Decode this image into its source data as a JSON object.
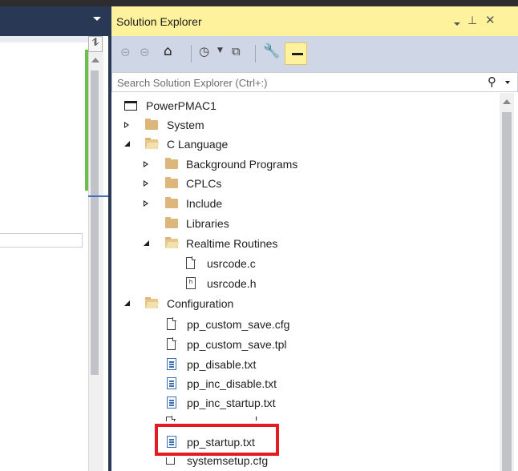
{
  "solution_explorer": {
    "title": "Solution Explorer",
    "pin_glyph": "Թ",
    "close_glyph": "✕",
    "toolbar": {
      "back_icon": "back-icon",
      "forward_icon": "forward-icon",
      "home_icon": "home-icon",
      "history_icon": "history-icon",
      "sync_icon": "sync-view-icon",
      "properties_icon": "wrench-icon",
      "preview_icon": "preview-icon"
    },
    "search_placeholder": "Search Solution Explorer (Ctrl+:)",
    "tree": {
      "project": "PowerPMAC1",
      "system": "System",
      "c_language": "C Language",
      "background_programs": "Background Programs",
      "cplcs": "CPLCs",
      "include": "Include",
      "libraries": "Libraries",
      "realtime_routines": "Realtime Routines",
      "usrcode_c": "usrcode.c",
      "usrcode_h": "usrcode.h",
      "configuration": "Configuration",
      "pp_custom_save_cfg": "pp_custom_save.cfg",
      "pp_custom_save_tpl": "pp_custom_save.tpl",
      "pp_disable": "pp_disable.txt",
      "pp_inc_disable": "pp_inc_disable.txt",
      "pp_inc_startup": "pp_inc_startup.txt",
      "pp_startup": "pp_startup.txt",
      "systemsetup": "systemsetup.cfg"
    }
  },
  "colors": {
    "title_active": "#fff29d",
    "toolbar_bg": "#cfd6e5",
    "frame": "#293955",
    "highlight_box": "#e41b23"
  }
}
